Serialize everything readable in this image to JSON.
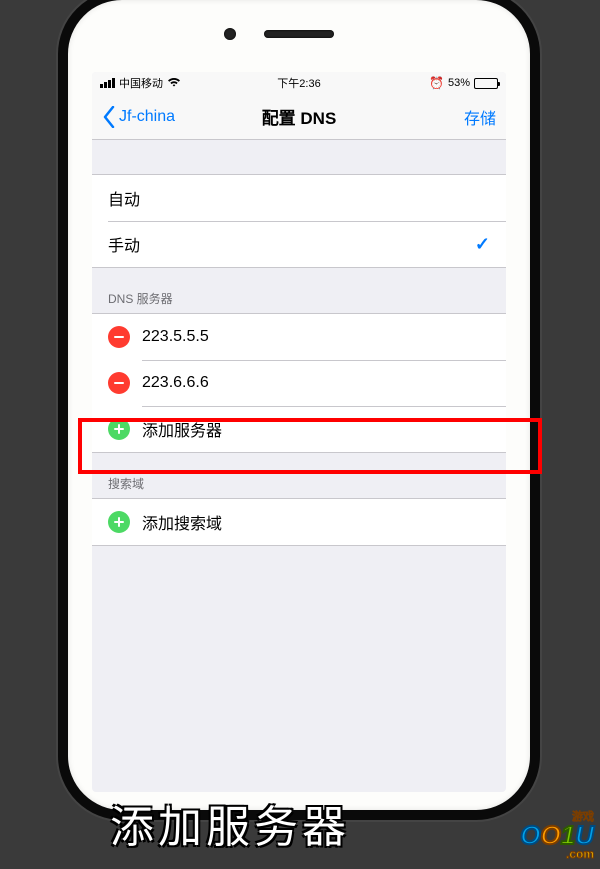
{
  "status": {
    "carrier": "中国移动",
    "time": "下午2:36",
    "battery_pct": "53%",
    "battery_fill_pct": 53
  },
  "nav": {
    "back_label": "Jf-china",
    "title": "配置 DNS",
    "save_label": "存储"
  },
  "dns_mode": {
    "auto": "自动",
    "manual": "手动"
  },
  "sections": {
    "dns_servers_header": "DNS 服务器",
    "servers": [
      {
        "ip": "223.5.5.5"
      },
      {
        "ip": "223.6.6.6"
      }
    ],
    "add_server_label": "添加服务器",
    "search_domains_header": "搜索域",
    "add_search_domain_label": "添加搜索域"
  },
  "caption": "添加服务器",
  "watermark": {
    "text": "OO1U",
    "tag": "游戏",
    "suffix": ".com"
  }
}
